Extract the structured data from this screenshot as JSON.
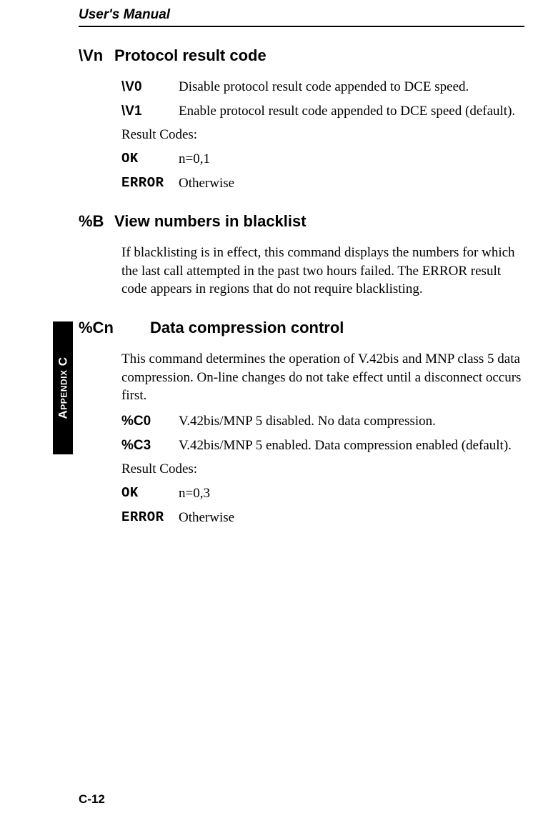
{
  "header": {
    "title": "User's Manual"
  },
  "sideTab": {
    "prefix": "A",
    "smallcaps": "PPENDIX",
    "suffix": " C"
  },
  "pageNumber": "C-12",
  "sections": [
    {
      "cmd": "\\Vn",
      "title": "Protocol result code",
      "paragraphs": [],
      "params": [
        {
          "code": "\\V0",
          "desc": "Disable protocol result code appended to DCE speed."
        },
        {
          "code": "\\V1",
          "desc": "Enable protocol result code appended to DCE speed (default)."
        }
      ],
      "resultLabel": "Result Codes:",
      "results": [
        {
          "code": "OK",
          "desc": "n=0,1"
        },
        {
          "code": "ERROR",
          "desc": "Otherwise"
        }
      ]
    },
    {
      "cmd": "%B",
      "title": "View numbers in blacklist",
      "paragraphs": [
        "If blacklisting is in effect, this command displays the numbers for which the last call attempted in the past two hours failed. The ERROR result code appears in regions that do not require blacklisting."
      ],
      "params": [],
      "resultLabel": "",
      "results": []
    },
    {
      "cmd": "%Cn",
      "cmdWide": true,
      "title": "Data compression control",
      "paragraphs": [
        "This command determines the operation of V.42bis and MNP class 5 data compression. On-line changes do not take effect until a disconnect occurs first."
      ],
      "params": [
        {
          "code": "%C0",
          "desc": "V.42bis/MNP 5 disabled. No data compression."
        },
        {
          "code": "%C3",
          "desc": "V.42bis/MNP 5 enabled. Data compression enabled (default)."
        }
      ],
      "resultLabel": "Result Codes:",
      "results": [
        {
          "code": "OK",
          "desc": "n=0,3"
        },
        {
          "code": "ERROR",
          "desc": "Otherwise"
        }
      ]
    }
  ]
}
